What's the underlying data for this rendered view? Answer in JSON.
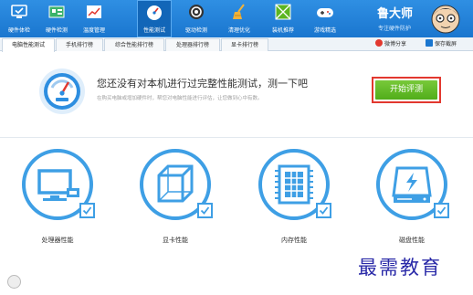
{
  "brand": {
    "title": "鲁大师",
    "slogan": "专注硬件防护"
  },
  "nav": [
    {
      "label": "硬件体检",
      "icon": "monitor-check-icon"
    },
    {
      "label": "硬件检测",
      "icon": "circuit-board-icon"
    },
    {
      "label": "温度管理",
      "icon": "thermometer-chart-icon"
    },
    {
      "label": "性能测试",
      "icon": "speedometer-icon"
    },
    {
      "label": "驱动检测",
      "icon": "gear-chip-icon"
    },
    {
      "label": "清理优化",
      "icon": "broom-icon"
    },
    {
      "label": "装机推荐",
      "icon": "box-icon"
    },
    {
      "label": "游戏精选",
      "icon": "gamepad-icon"
    }
  ],
  "tabs": [
    {
      "label": "电脑性能测试"
    },
    {
      "label": "手机排行榜"
    },
    {
      "label": "综合性能排行榜"
    },
    {
      "label": "处理器排行榜"
    },
    {
      "label": "显卡排行榜"
    }
  ],
  "actions": {
    "share": "微博分享",
    "save": "保存截屏"
  },
  "banner": {
    "headline": "您还没有对本机进行过完整性能测试，测一下吧",
    "subtext": "在购买电脑或增加硬件时，帮您对电脑性能进行评估，让您做到心中有数。",
    "button": "开始评测"
  },
  "cards": [
    {
      "label": "处理器性能",
      "icon": "cpu-monitor-icon",
      "checked": true
    },
    {
      "label": "显卡性能",
      "icon": "graphics-cube-icon",
      "checked": true
    },
    {
      "label": "内存性能",
      "icon": "memory-chip-icon",
      "checked": true
    },
    {
      "label": "磁盘性能",
      "icon": "disk-drive-icon",
      "checked": true
    }
  ],
  "watermark": "最需教育",
  "colors": {
    "accent": "#1a76cf",
    "card_ring": "#3e9fe5",
    "start_button": "#5cb521",
    "highlight": "#e2382f"
  }
}
